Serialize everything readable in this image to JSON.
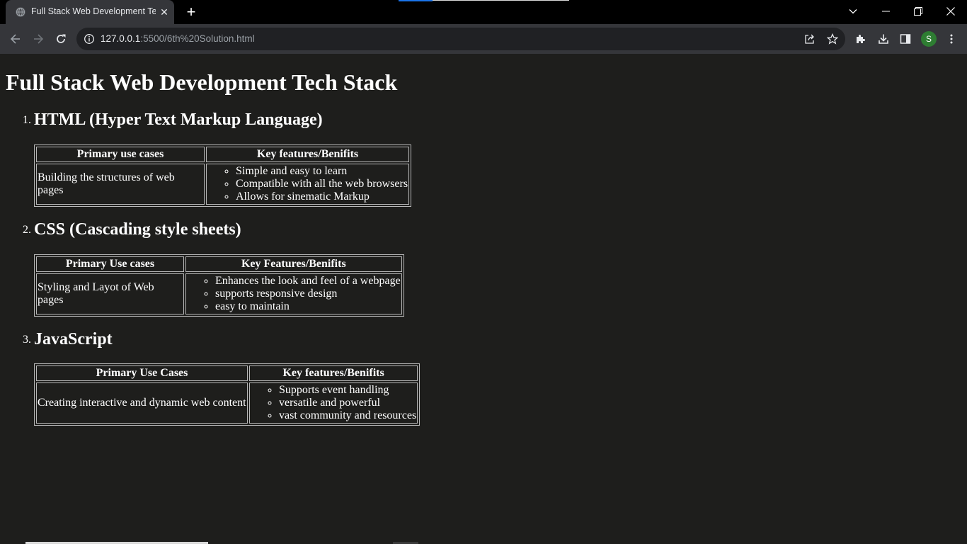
{
  "browser": {
    "tab_title": "Full Stack Web Development Tech Stack",
    "tab_close": "✕",
    "new_tab": "+",
    "url_host": "127.0.0.1",
    "url_rest": ":5500/6th%20Solution.html",
    "profile_initial": "S",
    "icons": [
      "back-icon",
      "forward-icon",
      "reload-icon",
      "info-icon",
      "share-icon",
      "star-icon",
      "extensions-icon",
      "download-icon",
      "side-panel-icon",
      "menu-icon"
    ]
  },
  "page": {
    "title": "Full Stack Web Development Tech Stack",
    "sections": [
      {
        "num": "1.",
        "heading": "HTML (Hyper Text Markup Language)",
        "col1": "Primary use cases",
        "col2": "Key features/Benifits",
        "use_case": "Building the structures of web pages",
        "features": [
          "Simple and easy to learn",
          "Compatible with all the web browsers",
          "Allows for sinematic Markup"
        ]
      },
      {
        "num": "2.",
        "heading": "CSS (Cascading style sheets)",
        "col1": "Primary Use cases",
        "col2": "Key Features/Benifits",
        "use_case": "Styling and Layot of Web pages",
        "features": [
          "Enhances the look and feel of a webpage",
          "supports responsive design",
          "easy to maintain"
        ]
      },
      {
        "num": "3.",
        "heading": "JavaScript",
        "col1": "Primary Use Cases",
        "col2": "Key features/Benifits",
        "use_case": "Creating interactive and dynamic web content",
        "features": [
          "Supports event handling",
          "versatile and powerful",
          "vast community and resources"
        ]
      }
    ]
  }
}
